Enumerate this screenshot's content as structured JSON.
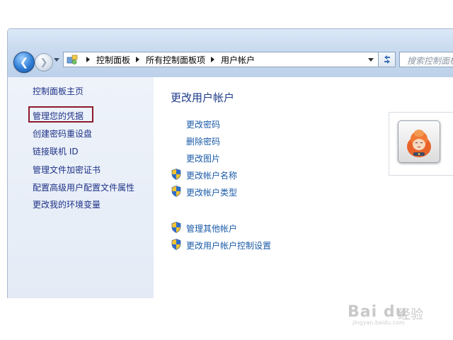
{
  "breadcrumb": {
    "items": [
      "控制面板",
      "所有控制面板项",
      "用户帐户"
    ]
  },
  "search": {
    "placeholder": "搜索控制面板"
  },
  "sidebar": {
    "home": "控制面板主页",
    "links": [
      "管理您的凭据",
      "创建密码重设盘",
      "链接联机 ID",
      "管理文件加密证书",
      "配置高级用户配置文件属性",
      "更改我的环境变量"
    ]
  },
  "main": {
    "title": "更改用户帐户",
    "tasks": [
      "更改密码",
      "删除密码",
      "更改图片",
      "更改帐户名称",
      "更改帐户类型"
    ],
    "other_tasks": [
      "管理其他帐户",
      "更改用户帐户控制设置"
    ]
  },
  "watermark": {
    "logo": "Bai du",
    "cn": "经验",
    "url": "jingyan.baidu.com"
  },
  "colors": {
    "link": "#1e3287",
    "task_link": "#1a5aa8",
    "title": "#1e3b8a",
    "highlight_box": "#8d1a2c",
    "chrome": "#c8daef"
  },
  "icons": {
    "back": "back-arrow-icon",
    "forward": "forward-arrow-icon",
    "control_panel": "control-panel-icon",
    "refresh": "refresh-icon",
    "uac": "uac-shield-icon",
    "avatar": "user-avatar-picture"
  }
}
